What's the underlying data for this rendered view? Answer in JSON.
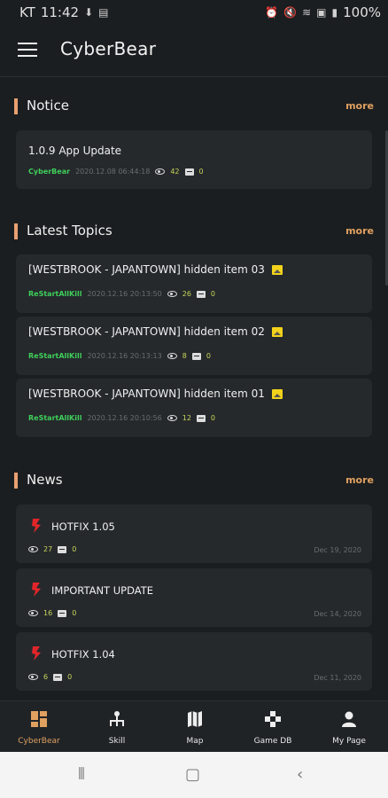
{
  "status": {
    "carrier": "KT",
    "time": "11:42",
    "battery": "100%"
  },
  "appbar": {
    "title": "CyberBear"
  },
  "notice": {
    "title": "Notice",
    "more": "more",
    "items": [
      {
        "title": "1.0.9 App Update",
        "author": "CyberBear",
        "date": "2020.12.08 06:44:18",
        "views": "42",
        "comments": "0"
      }
    ]
  },
  "latest": {
    "title": "Latest Topics",
    "more": "more",
    "items": [
      {
        "title": "[WESTBROOK - JAPANTOWN] hidden item 03",
        "author": "ReStartAllKill",
        "date": "2020.12.16 20:13:50",
        "views": "26",
        "comments": "0"
      },
      {
        "title": "[WESTBROOK - JAPANTOWN] hidden item 02",
        "author": "ReStartAllKill",
        "date": "2020.12.16 20:13:13",
        "views": "8",
        "comments": "0"
      },
      {
        "title": "[WESTBROOK - JAPANTOWN] hidden item 01",
        "author": "ReStartAllKill",
        "date": "2020.12.16 20:10:56",
        "views": "12",
        "comments": "0"
      }
    ]
  },
  "news": {
    "title": "News",
    "more": "more",
    "items": [
      {
        "title": "HOTFIX 1.05",
        "views": "27",
        "comments": "0",
        "date": "Dec 19, 2020"
      },
      {
        "title": "IMPORTANT UPDATE",
        "views": "16",
        "comments": "0",
        "date": "Dec 14, 2020"
      },
      {
        "title": "HOTFIX 1.04",
        "views": "6",
        "comments": "0",
        "date": "Dec 11, 2020"
      }
    ]
  },
  "bottomnav": {
    "items": [
      {
        "label": "CyberBear",
        "icon": "grid-icon"
      },
      {
        "label": "Skill",
        "icon": "skill-tree-icon"
      },
      {
        "label": "Map",
        "icon": "map-icon"
      },
      {
        "label": "Game DB",
        "icon": "gamepad-icon"
      },
      {
        "label": "My Page",
        "icon": "person-icon"
      }
    ]
  },
  "colors": {
    "accent": "#e0a060",
    "author": "#3fcf5a",
    "count": "#c7d65a",
    "image_badge": "#f2d21b",
    "news_logo": "#e0262a"
  }
}
